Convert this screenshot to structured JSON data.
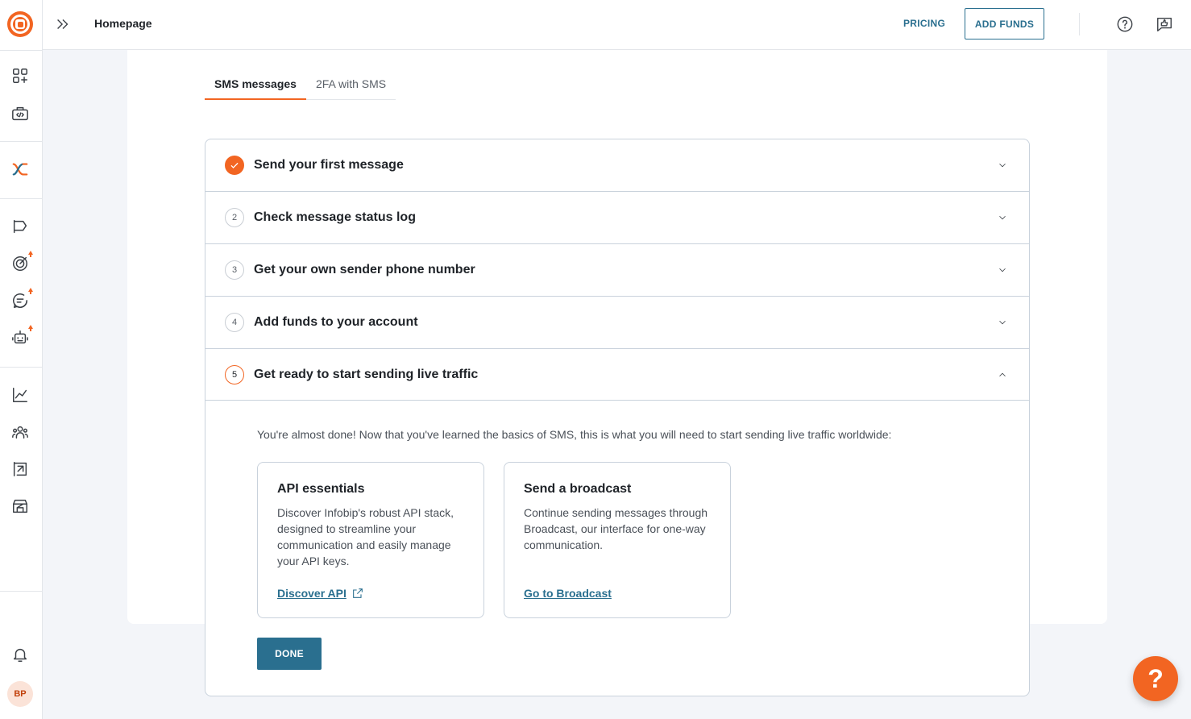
{
  "header": {
    "page_title": "Homepage",
    "pricing_label": "PRICING",
    "add_funds_label": "ADD FUNDS"
  },
  "user": {
    "initials": "BP"
  },
  "tabs": [
    {
      "label": "SMS messages",
      "active": true
    },
    {
      "label": "2FA with SMS",
      "active": false
    }
  ],
  "steps": [
    {
      "number": "1",
      "title": "Send your first message",
      "status": "done",
      "expanded": false
    },
    {
      "number": "2",
      "title": "Check message status log",
      "status": "pending",
      "expanded": false
    },
    {
      "number": "3",
      "title": "Get your own sender phone number",
      "status": "pending",
      "expanded": false
    },
    {
      "number": "4",
      "title": "Add funds to your account",
      "status": "pending",
      "expanded": false
    },
    {
      "number": "5",
      "title": "Get ready to start sending live traffic",
      "status": "current",
      "expanded": true
    }
  ],
  "expanded_step": {
    "intro": "You're almost done! Now that you've learned the basics of SMS, this is what you will need to start sending live traffic worldwide:",
    "cards": [
      {
        "title": "API essentials",
        "description": "Discover Infobip's robust API stack, designed to streamline your communication and easily manage your API keys.",
        "link_label": "Discover API"
      },
      {
        "title": "Send a broadcast",
        "description": "Continue sending messages through Broadcast, our interface for one-way communication.",
        "link_label": "Go to Broadcast"
      }
    ],
    "done_label": "DONE"
  },
  "help_fab_label": "?",
  "colors": {
    "brand_orange": "#f26522",
    "primary_teal": "#2a6f8f"
  }
}
